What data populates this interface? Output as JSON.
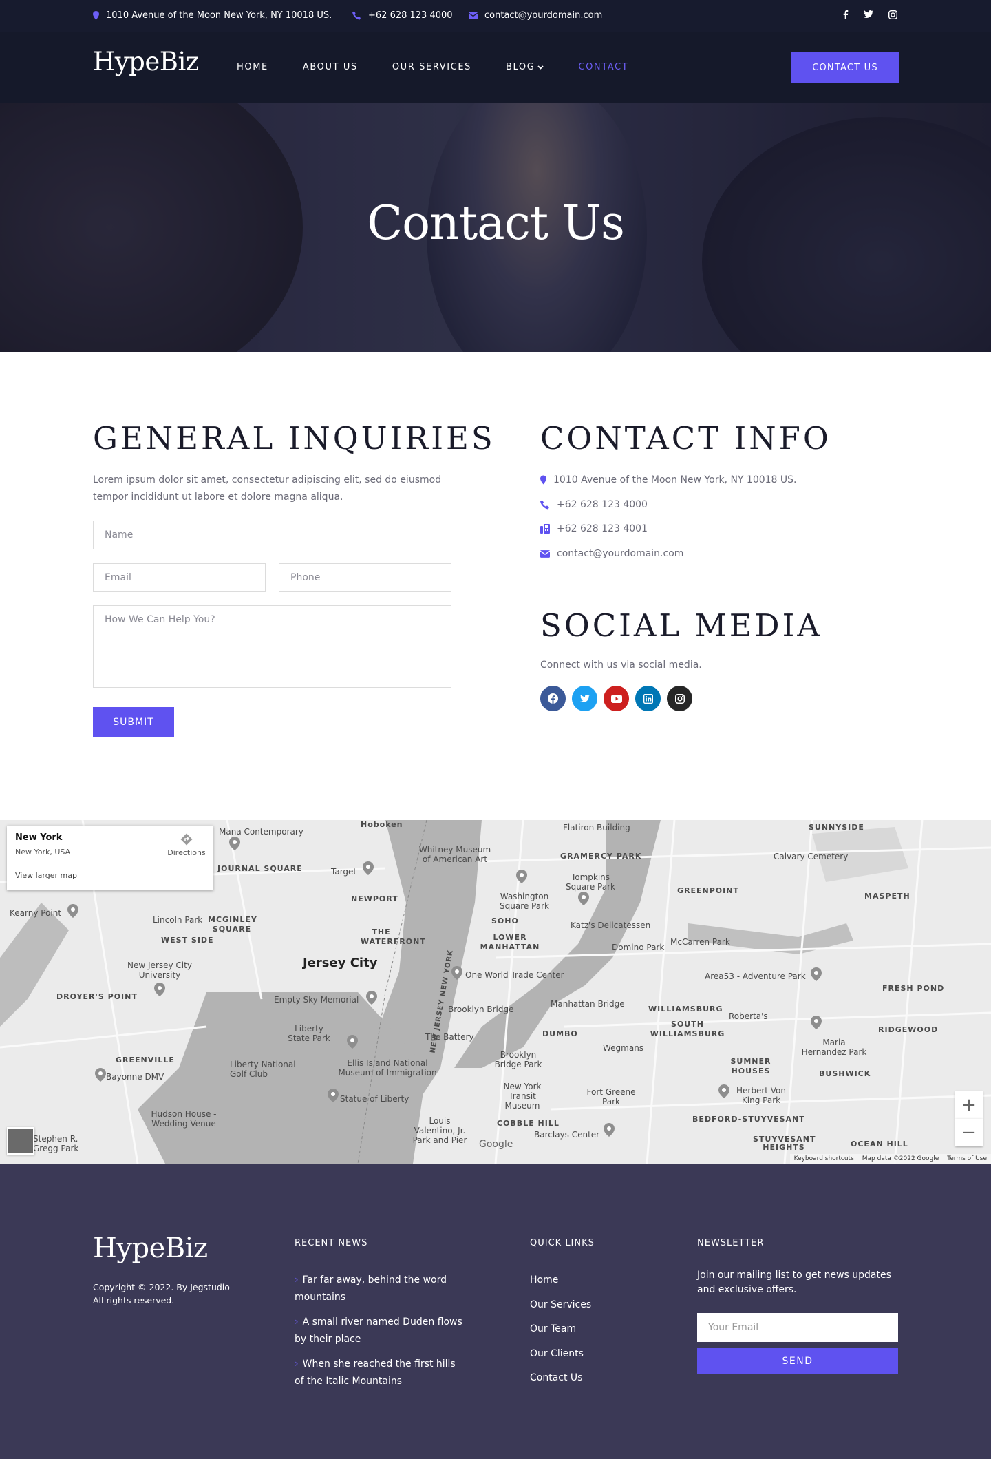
{
  "topbar": {
    "address": "1010 Avenue of the Moon New York, NY 10018 US.",
    "phone": "+62 628 123 4000",
    "email": "contact@yourdomain.com",
    "social_icons": [
      "facebook-icon",
      "twitter-icon",
      "instagram-icon"
    ]
  },
  "nav": {
    "logo": "HypeBiz",
    "links": [
      "HOME",
      "ABOUT US",
      "OUR SERVICES",
      "BLOG",
      "CONTACT"
    ],
    "active": "CONTACT",
    "cta": "CONTACT US"
  },
  "hero": {
    "title": "Contact Us"
  },
  "inquiries": {
    "title": "GENERAL INQUIRIES",
    "text": "Lorem ipsum dolor sit amet, consectetur adipiscing elit, sed do eiusmod tempor incididunt ut labore et dolore magna aliqua.",
    "name_placeholder": "Name",
    "email_placeholder": "Email",
    "phone_placeholder": "Phone",
    "message_placeholder": "How We Can Help You?",
    "submit": "SUBMIT"
  },
  "contact_info": {
    "title": "CONTACT INFO",
    "address": "1010 Avenue of the Moon New York, NY 10018 US.",
    "phone": "+62 628 123 4000",
    "fax": "+62 628 123 4001",
    "email": "contact@yourdomain.com"
  },
  "social": {
    "title": "SOCIAL MEDIA",
    "text": "Connect with us via social media.",
    "icons": [
      {
        "name": "facebook-icon",
        "color": "#3b5998"
      },
      {
        "name": "twitter-icon",
        "color": "#1da1f2"
      },
      {
        "name": "youtube-icon",
        "color": "#cd201f"
      },
      {
        "name": "linkedin-icon",
        "color": "#0077b5"
      },
      {
        "name": "instagram-icon",
        "color": "#262626"
      }
    ]
  },
  "map": {
    "place_title": "New York",
    "place_sub": "New York, USA",
    "directions": "Directions",
    "larger_map": "View larger map",
    "labels": {
      "jersey_city": "Jersey City",
      "hoboken": "Hoboken",
      "flatiron": "Flatiron Building",
      "sunnyside": "SUNNYSIDE",
      "mana": "Mana Contemporary",
      "whitney": "Whitney Museum of American Art",
      "gramercy": "GRAMERCY PARK",
      "calvary": "Calvary Cemetery",
      "journal": "JOURNAL SQUARE",
      "target": "Target",
      "tompkins": "Tompkins Square Park",
      "greenpoint": "GREENPOINT",
      "maspeth": "MASPETH",
      "kearny": "Kearny Point",
      "newport": "NEWPORT",
      "washington": "Washington Square Park",
      "lincoln": "Lincoln Park",
      "mcginley": "MCGINLEY SQUARE",
      "soho": "SOHO",
      "katz": "Katz's Delicatessen",
      "westside": "WEST SIDE",
      "waterfront": "THE WATERFRONT",
      "lowerman": "LOWER MANHATTAN",
      "domino": "Domino Park",
      "mccarren": "McCarren Park",
      "njcu": "New Jersey City University",
      "owtc": "One World Trade Center",
      "area53": "Area53 - Adventure Park",
      "freshpond": "FRESH POND",
      "droyers": "DROYER'S POINT",
      "emptysky": "Empty Sky Memorial",
      "nj_ny": "NEW JERSEY NEW YORK",
      "brooklynbridge": "Brooklyn Bridge",
      "manhattanbridge": "Manhattan Bridge",
      "williamsburg": "WILLIAMSBURG",
      "roberta": "Roberta's",
      "southwb": "SOUTH WILLIAMSBURG",
      "ridgewood": "RIDGEWOOD",
      "liberty": "Liberty State Park",
      "battery": "The Battery",
      "dumbo": "DUMBO",
      "wegmans": "Wegmans",
      "maria": "Maria Hernandez Park",
      "greenville": "GREENVILLE",
      "libnat": "Liberty National Golf Club",
      "ellis": "Ellis Island National Museum of Immigration",
      "bbpark": "Brooklyn Bridge Park",
      "sumner": "SUMNER HOUSES",
      "bushwick": "BUSHWICK",
      "bayonne": "Bayonne DMV",
      "statue": "Statue of Liberty",
      "transit": "New York Transit Museum",
      "fortgreene": "Fort Greene Park",
      "herbert": "Herbert Von King Park",
      "hudson": "Hudson House - Wedding Venue",
      "louis": "Louis Valentino, Jr. Park and Pier",
      "cobble": "COBBLE HILL",
      "barclays": "Barclays Center",
      "bedstuy": "BEDFORD-STUYVESANT",
      "stuyheights": "STUYVESANT HEIGHTS",
      "oceanhill": "OCEAN HILL",
      "stephen": "Stephen R. Gregg Park"
    },
    "zoom_in": "+",
    "zoom_out": "−",
    "google": "Google",
    "shortcuts": "Keyboard shortcuts",
    "mapdata": "Map data ©2022 Google",
    "terms": "Terms of Use"
  },
  "footer": {
    "logo": "HypeBiz",
    "copyright": "Copyright © 2022. By Jegstudio",
    "rights": "All rights reserved.",
    "news_title": "RECENT NEWS",
    "news": [
      "Far far away, behind the word mountains",
      "A small river named Duden flows by their place",
      "When she reached the first hills of the Italic Mountains"
    ],
    "links_title": "QUICK LINKS",
    "links": [
      "Home",
      "Our Services",
      "Our Team",
      "Our Clients",
      "Contact Us"
    ],
    "newsletter_title": "NEWSLETTER",
    "newsletter_text": "Join our mailing list to get news updates and exclusive offers.",
    "email_placeholder": "Your Email",
    "send": "SEND"
  },
  "colors": {
    "accent": "#5f52f0",
    "topbar": "#171b2e",
    "footer": "#3b3956"
  }
}
